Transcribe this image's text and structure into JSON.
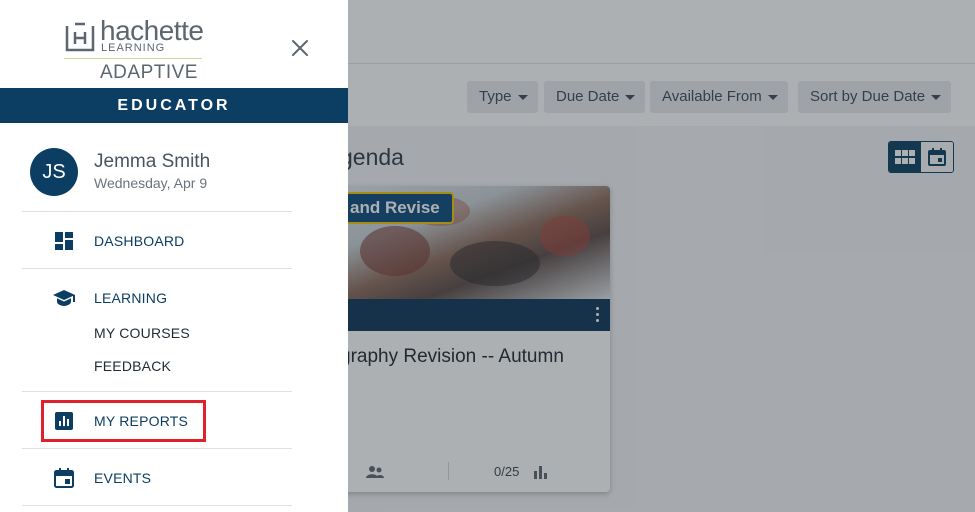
{
  "brand": {
    "wordmark": "hachette",
    "subline": "LEARNING",
    "product": "ADAPTIVE",
    "colors": {
      "navy": "#0b3e62",
      "highlight": "#e0202a"
    }
  },
  "drawer": {
    "role": "EDUCATOR",
    "user": {
      "initials": "JS",
      "name": "Jemma Smith",
      "date": "Wednesday, Apr 9"
    },
    "nav": {
      "dashboard": {
        "label": "DASHBOARD",
        "icon": "dashboard-icon"
      },
      "learning": {
        "label": "LEARNING",
        "icon": "graduation-cap-icon",
        "children": [
          "MY COURSES",
          "FEEDBACK"
        ]
      },
      "reports": {
        "label": "MY REPORTS",
        "icon": "bar-chart-icon"
      },
      "events": {
        "label": "EVENTS",
        "icon": "calendar-icon"
      }
    },
    "close_icon": "close-icon"
  },
  "background": {
    "filters": [
      "Type",
      "Due Date",
      "Available From",
      "Sort by Due Date"
    ],
    "section_title": "genda",
    "card": {
      "tag": "and Revise",
      "title": "graphy Revision -- Autumn",
      "progress": "0/25"
    }
  }
}
